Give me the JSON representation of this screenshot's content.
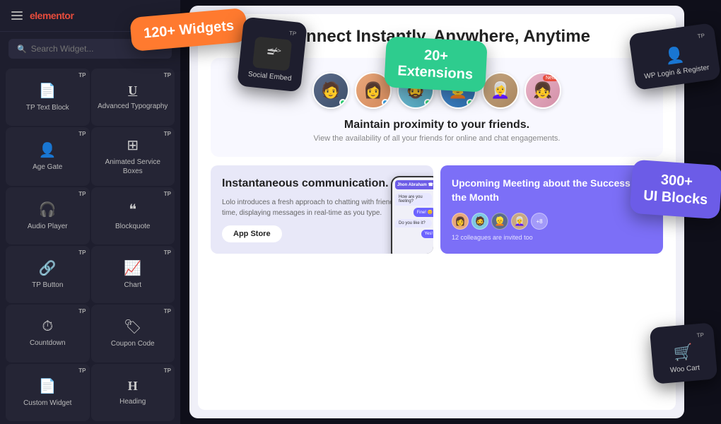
{
  "app": {
    "name": "elementor",
    "search_placeholder": "Search Widget..."
  },
  "badges": {
    "widgets": "120+\nWidgets",
    "extensions": "20+\nExtensions",
    "ui_blocks": "300+\nUI Blocks"
  },
  "floating_cards": {
    "embed_social": {
      "label": "Social Embed",
      "tp": "TP"
    },
    "wp_login": {
      "label": "WP Login & Register",
      "tp": "TP"
    },
    "woo_cart": {
      "label": "Woo Cart",
      "tp": "TP"
    }
  },
  "sidebar": {
    "widgets": [
      {
        "icon": "📄",
        "label": "TP Text Block",
        "tp": "TP"
      },
      {
        "icon": "U̲",
        "label": "Advanced Typography",
        "tp": "TP"
      },
      {
        "icon": "👤",
        "label": "Age Gate",
        "tp": "TP"
      },
      {
        "icon": "⊞",
        "label": "Animated Service Boxes",
        "tp": "TP"
      },
      {
        "icon": "🎧",
        "label": "Audio Player",
        "tp": "TP"
      },
      {
        "icon": "❝",
        "label": "Blockquote",
        "tp": "TP"
      },
      {
        "icon": "🔗",
        "label": "TP Button",
        "tp": "TP"
      },
      {
        "icon": "📊",
        "label": "Chart",
        "tp": "TP"
      },
      {
        "icon": "⏱",
        "label": "Countdown",
        "tp": "TP"
      },
      {
        "icon": "🏷",
        "label": "Coupon Code",
        "tp": "TP"
      },
      {
        "icon": "📄",
        "label": "Custom Widget",
        "tp": "TP"
      },
      {
        "icon": "H",
        "label": "Heading",
        "tp": "TP"
      }
    ]
  },
  "main": {
    "title": "Connect Instantly, Anywhere, Anytime",
    "proximity_title": "Maintain proximity to your friends.",
    "proximity_sub": "View the availability of all your friends for online and chat engagements.",
    "comm_card": {
      "title": "Instantaneous communication.",
      "text": "Lolo introduces a fresh approach to chatting with friends in live time, displaying messages in real-time as you type.",
      "btn": "App Store"
    },
    "meeting_card": {
      "title": "Upcoming Meeting about the Success of the Month",
      "sub": "12 colleagues are invited too",
      "more": "+8"
    }
  }
}
